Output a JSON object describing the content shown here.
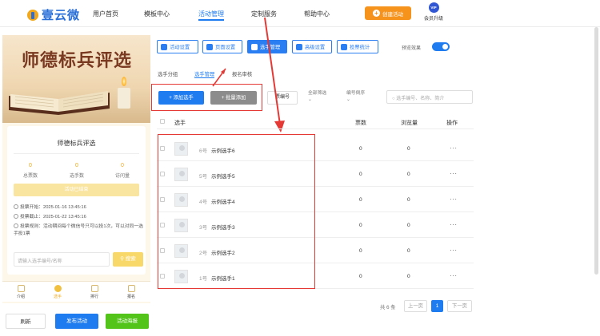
{
  "logo": {
    "text": "壹云微"
  },
  "nav": {
    "items": [
      "用户首页",
      "模板中心",
      "活动管理",
      "定制服务",
      "帮助中心"
    ],
    "active_index": 2,
    "create_label": "创建活动",
    "vip_badge": "VIP",
    "vip_label": "会员升级"
  },
  "preview": {
    "banner_title": "师德标兵评选",
    "card_title": "师德标兵评选",
    "stats": [
      {
        "value": "0",
        "label": "总票数"
      },
      {
        "value": "0",
        "label": "选手数"
      },
      {
        "value": "0",
        "label": "访问量"
      }
    ],
    "ended_label": "活动已结束",
    "vote_start": "投票开始：2025-01-16 13:45:16",
    "vote_end": "投票截止：2025-01-22 13:45:16",
    "vote_rule": "投票规则：活动期间每个微信号只可以投1次，可以对同一选手投1票",
    "search_placeholder": "请输入选手编号/名称",
    "search_button": "搜索",
    "tabs": [
      "介绍",
      "选手",
      "排行",
      "报名"
    ],
    "active_tab": 1
  },
  "bottom_buttons": {
    "refresh": "刷新",
    "publish": "发布活动",
    "poster": "活动海报"
  },
  "toolbar": {
    "buttons": [
      "活动设置",
      "页面设置",
      "选手管理",
      "高级设置",
      "投票统计"
    ],
    "active_index": 2,
    "preview_label": "预览效果",
    "preview_on": true
  },
  "subtabs": {
    "items": [
      "选手分组",
      "选手管理",
      "报名审核"
    ],
    "active_index": 1
  },
  "actions": {
    "add": "+ 添加选手",
    "batch": "+ 批量添加",
    "sort": "票编号",
    "filter_all": "全部筛选",
    "filter_sort": "编号倒序",
    "search_placeholder": "选手编号、名称、简介"
  },
  "table": {
    "headers": {
      "player": "选手",
      "votes": "票数",
      "views": "浏览量",
      "ops": "操作"
    },
    "rows": [
      {
        "no": "6号",
        "name": "示例选手6",
        "votes": "0",
        "views": "0",
        "ops": "···"
      },
      {
        "no": "5号",
        "name": "示例选手5",
        "votes": "0",
        "views": "0",
        "ops": "···"
      },
      {
        "no": "4号",
        "name": "示例选手4",
        "votes": "0",
        "views": "0",
        "ops": "···"
      },
      {
        "no": "3号",
        "name": "示例选手3",
        "votes": "0",
        "views": "0",
        "ops": "···"
      },
      {
        "no": "2号",
        "name": "示例选手2",
        "votes": "0",
        "views": "0",
        "ops": "···"
      },
      {
        "no": "1号",
        "name": "示例选手1",
        "votes": "0",
        "views": "0",
        "ops": "···"
      }
    ]
  },
  "pagination": {
    "total": "共 6 条",
    "prev": "上一页",
    "current": "1",
    "next": "下一页"
  },
  "colors": {
    "primary": "#1f7cf0",
    "accent": "#f6931d",
    "highlight": "#e53935",
    "gold": "#f2a818"
  }
}
